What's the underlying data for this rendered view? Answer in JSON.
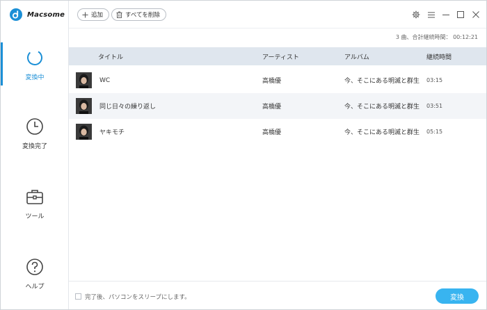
{
  "app": {
    "name": "Macsome"
  },
  "sidebar": {
    "items": [
      {
        "label": "変換中",
        "icon": "spinner-icon",
        "active": true
      },
      {
        "label": "変換完了",
        "icon": "clock-icon",
        "active": false
      },
      {
        "label": "ツール",
        "icon": "toolbox-icon",
        "active": false
      },
      {
        "label": "ヘルプ",
        "icon": "help-icon",
        "active": false
      }
    ]
  },
  "toolbar": {
    "add_label": "追加",
    "remove_all_label": "すべてを削除"
  },
  "summary": "3 曲、合計継続時間： 00:12:21",
  "table": {
    "headers": {
      "title": "タイトル",
      "artist": "アーティスト",
      "album": "アルバム",
      "duration": "継続時間"
    },
    "rows": [
      {
        "title": "WC",
        "artist": "高橋優",
        "album": "今、そこにある明滅と群生",
        "duration": "03:15"
      },
      {
        "title": "同じ日々の繰り返し",
        "artist": "高橋優",
        "album": "今、そこにある明滅と群生",
        "duration": "03:51"
      },
      {
        "title": "ヤキモチ",
        "artist": "高橋優",
        "album": "今、そこにある明滅と群生",
        "duration": "05:15"
      }
    ]
  },
  "footer": {
    "sleep_label": "完了後、パソコンをスリープにします。",
    "convert_label": "変換"
  },
  "colors": {
    "accent": "#1b8fd6",
    "button": "#38b4f0",
    "header_bg": "#dfe6ee"
  }
}
